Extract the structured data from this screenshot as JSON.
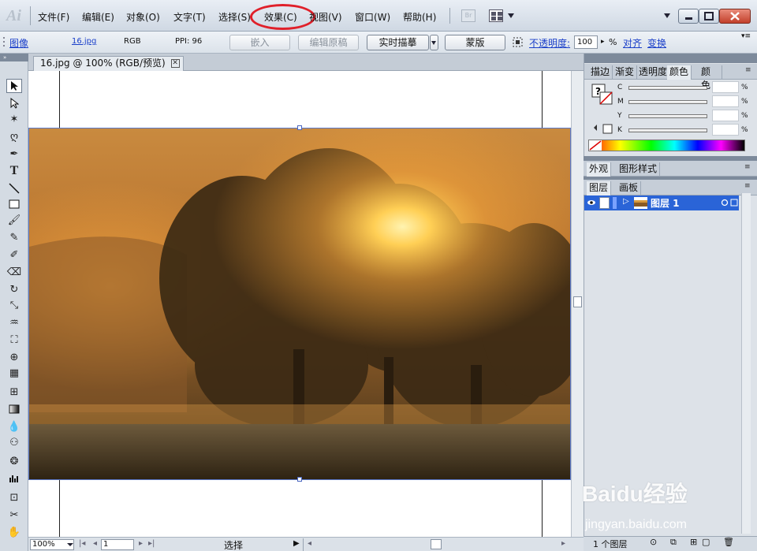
{
  "app": {
    "logo": "Ai"
  },
  "menu": [
    "文件(F)",
    "编辑(E)",
    "对象(O)",
    "文字(T)",
    "选择(S)",
    "效果(C)",
    "视图(V)",
    "窗口(W)",
    "帮助(H)"
  ],
  "menu_highlight_color": "#e0202a",
  "bridge_label": "Br",
  "control": {
    "image_link": "图像",
    "filename": "16.jpg",
    "mode": "RGB",
    "ppi": "PPI: 96",
    "embed": "嵌入",
    "edit_original": "编辑原稿",
    "live_trace": "实时描摹",
    "mask": "蒙版",
    "opacity_label": "不透明度:",
    "opacity_value": "100",
    "percent": "%",
    "align": "对齐",
    "transform": "变换"
  },
  "document": {
    "tab_title": "16.jpg @ 100% (RGB/预览)"
  },
  "status": {
    "zoom": "100%",
    "page": "1",
    "tool": "选择"
  },
  "panels": {
    "color_tabs": [
      "描边",
      "渐变",
      "透明度",
      "颜色",
      "颜色"
    ],
    "color_channels": [
      "C",
      "M",
      "Y",
      "K"
    ],
    "percent": "%",
    "appearance_tabs": [
      "外观",
      "图形样式"
    ],
    "layer_tabs": [
      "图层",
      "画板"
    ],
    "layer_name": "图层 1",
    "layer_count": "1 个图层"
  },
  "watermark": {
    "main": "Baidu经验",
    "sub": "jingyan.baidu.com"
  }
}
